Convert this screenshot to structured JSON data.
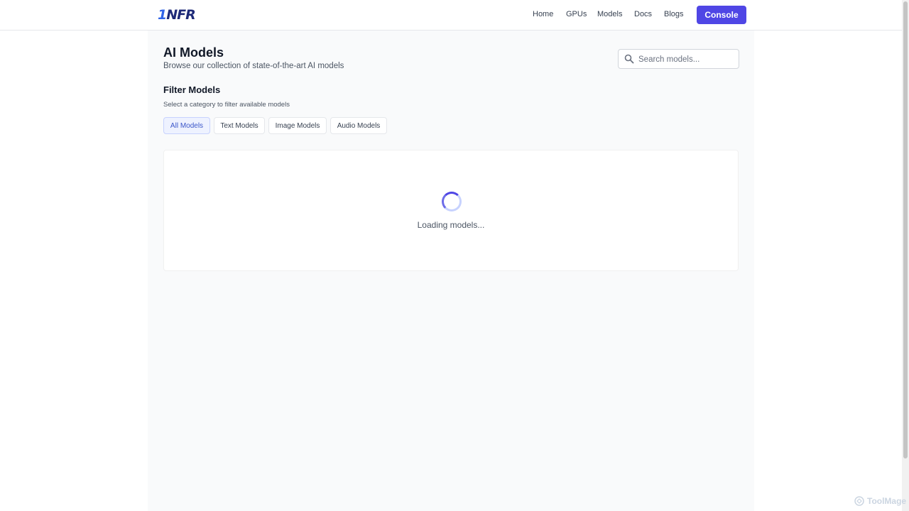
{
  "header": {
    "logo_prefix": "1",
    "logo_rest": "NFR",
    "nav": [
      "Home",
      "GPUs",
      "Models",
      "Docs",
      "Blogs"
    ],
    "console_label": "Console"
  },
  "page": {
    "title": "AI Models",
    "subtitle": "Browse our collection of state-of-the-art AI models"
  },
  "search": {
    "placeholder": "Search models...",
    "icon": "search-icon"
  },
  "filters": {
    "title": "Filter Models",
    "subtitle": "Select a category to filter available models",
    "chips": [
      "All Models",
      "Text Models",
      "Image Models",
      "Audio Models"
    ],
    "selected": "All Models"
  },
  "status": {
    "loading_text": "Loading models..."
  },
  "watermark": {
    "text": "ToolMage"
  },
  "colors": {
    "accent": "#4f46e5",
    "background": "#f9fafb",
    "active_chip_bg": "#eef2ff"
  }
}
